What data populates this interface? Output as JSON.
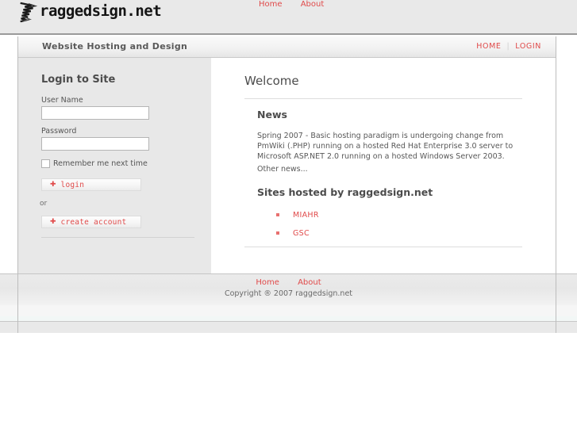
{
  "masthead": {
    "logo_text": "raggedsign.net",
    "logo_icon": "ragged-mark-icon",
    "nav": [
      {
        "label": "Home"
      },
      {
        "label": "About"
      }
    ]
  },
  "subtitle_bar": {
    "tagline": "Website Hosting and Design",
    "util_nav": [
      {
        "label": "HOME"
      },
      {
        "label": "LOGIN"
      }
    ],
    "separator": "|"
  },
  "sidebar": {
    "title": "Login to Site",
    "username": {
      "label": "User Name",
      "value": "",
      "placeholder": ""
    },
    "password": {
      "label": "Password",
      "value": "",
      "placeholder": ""
    },
    "remember": {
      "label": "Remember me next time",
      "checked": false
    },
    "login_button": {
      "label": "login",
      "icon": "plus-arrow-icon"
    },
    "or_text": "or",
    "create_button": {
      "label": "create account",
      "icon": "plus-arrow-icon"
    }
  },
  "main": {
    "welcome_heading": "Welcome",
    "news_heading": "News",
    "news_body": "Spring 2007 - Basic hosting paradigm is undergoing change from PmWiki (.PHP) running on a hosted Red Hat Enterprise 3.0 server to Microsoft ASP.NET 2.0 running on a hosted Windows Server 2003.",
    "other_news": "Other news...",
    "sites_heading": "Sites hosted by raggedsign.net",
    "sites": [
      {
        "label": "MIAHR"
      },
      {
        "label": "GSC"
      }
    ]
  },
  "footer": {
    "nav": [
      {
        "label": "Home"
      },
      {
        "label": "About"
      }
    ],
    "copyright": "Copyright ® 2007 raggedsign.net"
  },
  "colors": {
    "accent_red": "#e04a4a",
    "bullet_red": "#e8706f",
    "sidebar_bg": "#e8e8e8",
    "masthead_bg": "#e9e9e9",
    "text_gray": "#585858",
    "heading_gray": "#4c4c4c"
  }
}
